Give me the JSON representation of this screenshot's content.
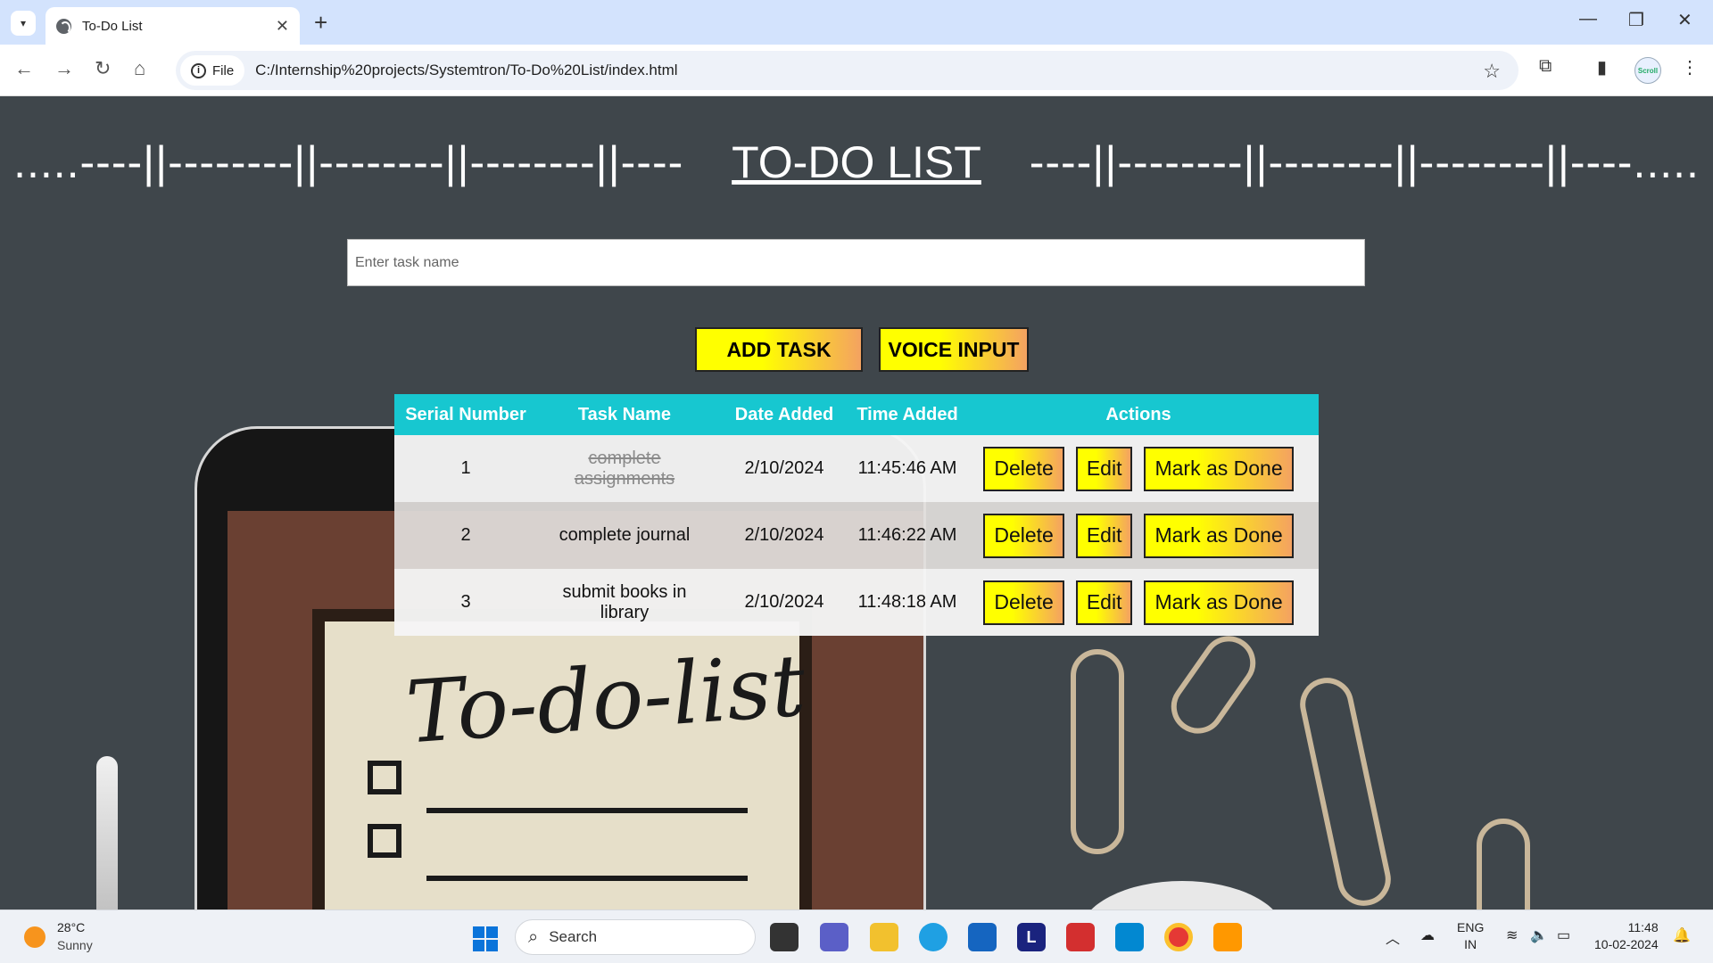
{
  "browser": {
    "tab_title": "To-Do List",
    "chip_label": "File",
    "url": "C:/Internship%20projects/Systemtron/To-Do%20List/index.html",
    "profile_label": "Scroll"
  },
  "page": {
    "heading_left": ".....----||--------||--------||--------||----",
    "heading_title": "TO-DO LIST",
    "heading_right": "----||--------||--------||--------||----.....",
    "input_placeholder": "Enter task name",
    "add_task_label": "ADD TASK",
    "voice_input_label": "VOICE INPUT",
    "background_text": "To-do-list"
  },
  "table": {
    "headers": [
      "Serial Number",
      "Task Name",
      "Date Added",
      "Time Added",
      "Actions"
    ],
    "rows": [
      {
        "serial": "1",
        "task": "complete assignments",
        "date": "2/10/2024",
        "time": "11:45:46 AM",
        "done": true
      },
      {
        "serial": "2",
        "task": "complete journal",
        "date": "2/10/2024",
        "time": "11:46:22 AM",
        "done": false
      },
      {
        "serial": "3",
        "task": "submit books in library",
        "date": "2/10/2024",
        "time": "11:48:18 AM",
        "done": false
      }
    ],
    "delete_label": "Delete",
    "edit_label": "Edit",
    "mark_done_label": "Mark as Done"
  },
  "taskbar": {
    "temperature": "28°C",
    "weather": "Sunny",
    "search_label": "Search",
    "lang_top": "ENG",
    "lang_bottom": "IN",
    "time": "11:48",
    "date": "10-02-2024"
  },
  "colors": {
    "table_header": "#17c7d0",
    "button_gradient_start": "#ffff00",
    "button_gradient_end": "#f4a261"
  }
}
